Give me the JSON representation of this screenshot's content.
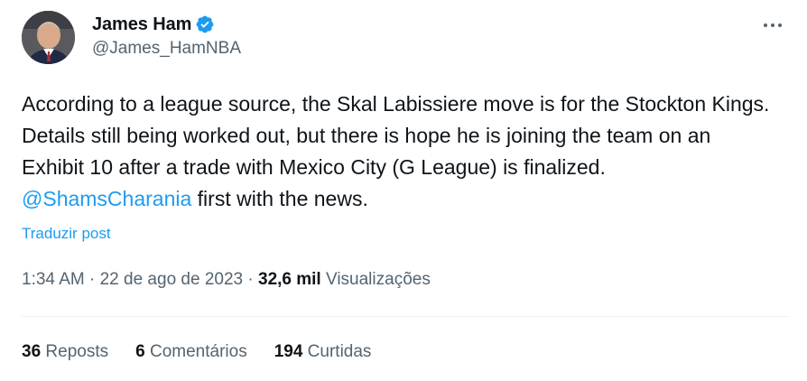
{
  "author": {
    "display_name": "James Ham",
    "handle": "@James_HamNBA",
    "verified": true,
    "avatar": "profile-photo"
  },
  "tweet": {
    "text_before": "According to a league source,  the Skal Labissiere move is for the Stockton Kings. Details still being worked out, but there is hope he is joining the team on an Exhibit 10 after a trade with Mexico City (G League) is finalized. ",
    "mention": "@ShamsCharania",
    "text_after": " first with the news."
  },
  "translate_label": "Traduzir post",
  "meta": {
    "time": "1:34 AM",
    "separator": " · ",
    "date": "22 de ago de 2023",
    "views_count": "32,6 mil",
    "views_label": " Visualizações"
  },
  "stats": {
    "reposts": {
      "count": "36",
      "label": " Reposts"
    },
    "comments": {
      "count": "6",
      "label": " Comentários"
    },
    "likes": {
      "count": "194",
      "label": " Curtidas"
    }
  },
  "colors": {
    "accent": "#1d9bf0",
    "text": "#0f1419",
    "muted": "#536471",
    "divider": "#eff3f4"
  },
  "icons": {
    "verified": "verified-badge-icon",
    "more": "more-horizontal-icon"
  }
}
